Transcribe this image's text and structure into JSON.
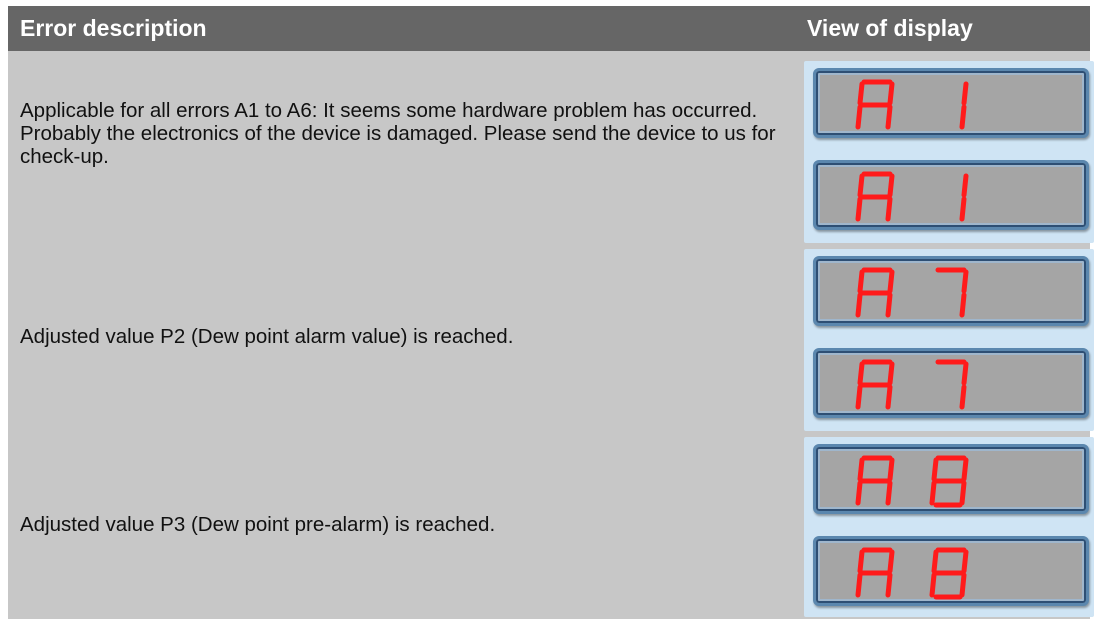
{
  "header": {
    "col_description": "Error description",
    "col_display": "View of display"
  },
  "rows": [
    {
      "description": "Applicable for all errors A1 to A6: It seems some hardware problem has occurred. Probably the electronics  of the device is damaged. Please send the device to us for check-up.",
      "display_chars": [
        "A",
        "1"
      ]
    },
    {
      "description": "Adjusted value P2 (Dew point alarm value) is reached.",
      "display_chars": [
        "A",
        "7"
      ]
    },
    {
      "description": "Adjusted value P3 (Dew point pre-alarm) is reached.",
      "display_chars": [
        "A",
        "8"
      ]
    }
  ],
  "colors": {
    "header_bg": "#666666",
    "body_bg": "#c7c7c7",
    "panel_bg": "#cfe4f4",
    "display_border": "#5b87ae",
    "display_face": "#a5a5a5",
    "segment": "#ff1a1a"
  }
}
